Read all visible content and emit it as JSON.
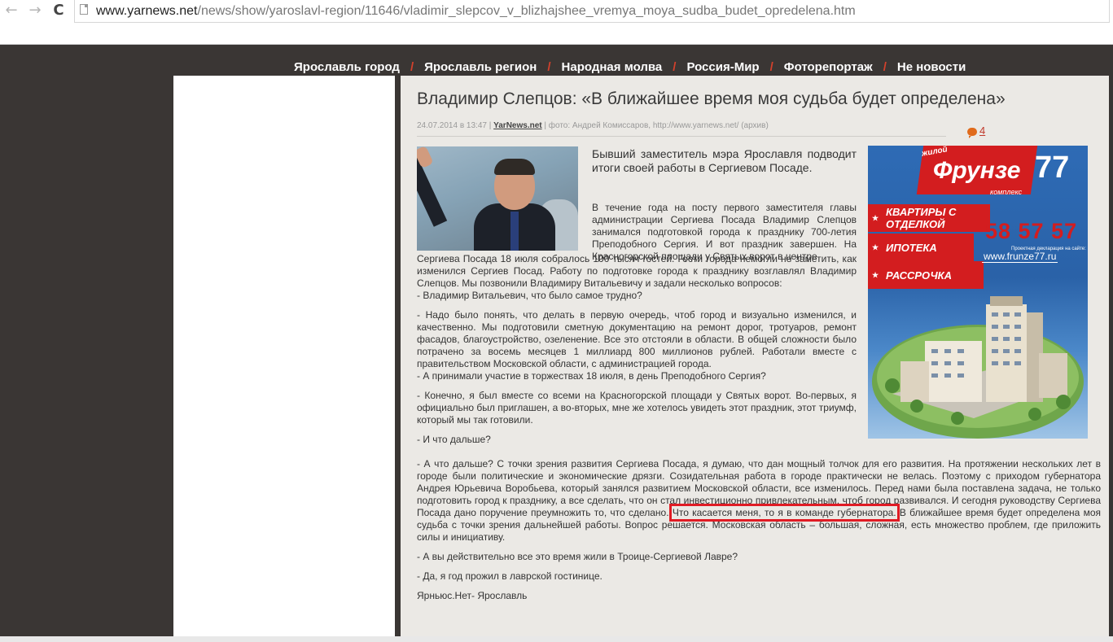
{
  "browser": {
    "url_domain": "www.yarnews.net",
    "url_path": "/news/show/yaroslavl-region/11646/vladimir_slepcov_v_blizhajshee_vremya_moya_sudba_budet_opredelena.htm",
    "back_glyph": "←",
    "forward_glyph": "→",
    "reload_glyph": "C"
  },
  "nav": {
    "items": [
      "Ярославль город",
      "Ярославль регион",
      "Народная молва",
      "Россия-Мир",
      "Фоторепортаж",
      "Не новости"
    ],
    "separator": "/"
  },
  "article": {
    "title": "Владимир Слепцов: «В ближайшее время моя судьба будет определена»",
    "date": "24.07.2014 в 13:47",
    "sep": "|",
    "source": "YarNews.net",
    "photo_credit": "| фото: Андрей Комиссаров, http://www.yarnews.net/ (архив)",
    "comments_count": "4",
    "lead": "Бывший заместитель мэра Ярославля подводит итоги своей работы в Сергиевом Посаде.",
    "p1": "В течение года на посту первого заместителя главы администрации Сергиева Посада Владимир Слепцов занимался подготовкой города к празднику 700-летия Преподобного Сергия. И вот праздник завершен. На Красногорской площади у Святых ворот в центре",
    "p1_cont": "Сергиева Посада 18 июля собралось 100 тысяч гостей. Гости города немогли не заметить, как изменился Сергиев Посад. Работу по подготовке города к празднику возглавлял Владимир Слепцов. Мы позвонили Владимиру Витальевичу и задали несколько вопросов:",
    "q1": "-  Владимир Витальевич, что было самое трудно?",
    "a1": "- Надо было понять, что делать в первую очередь, чтоб город и визуально изменился, и качественно. Мы подготовили сметную документацию на ремонт дорог, тротуаров, ремонт фасадов, благоустройство, озеленение. Все это отстояли в области. В общей сложности было потрачено за восемь месяцев 1 миллиард 800 миллионов рублей. Работали вместе с правительством Московской области, с администрацией города.",
    "q2": "- А принимали участие в торжествах 18 июля, в день Преподобного Сергия?",
    "a2": "- Конечно, я был вместе со всеми на Красногорской площади у Святых ворот. Во-первых, я официально был приглашен, а во-вторых, мне же хотелось увидеть этот праздник, этот триумф, который мы так готовили.",
    "q3": "- И что дальше?",
    "a3_before": "- А что дальше? С точки зрения развития Сергиева Посада, я думаю, что дан мощный толчок для его развития. На протяжении нескольких лет в городе были политические и экономические дрязги. Созидательная работа в городе практически не велась. Поэтому с приходом губернатора Андрея Юрьевича Воробьева, который занялся развитием Московской области, все изменилось. Перед нами была поставлена задача, не только подготовить город к празднику, а все сделать, что он стал инвестиционно привлекательным, чтоб город развивался. И сегодня руководству Сергиева Посада дано поручение преумножить то, что сделано. ",
    "a3_highlight": "Что касается меня, то я в команде губернатора.",
    "a3_after": " В ближайшее время будет определена моя судьба с точки зрения дальнейшей работы. Вопрос решается. Московская область – большая, сложная, есть множество проблем, где приложить силы и инициативу.",
    "q4": "- А вы действительно все это время жили в Троице-Сергиевой Лавре?",
    "a4": "- Да, я год прожил в лаврской гостинице.",
    "signature": "Ярньюс.Нет- Ярославль"
  },
  "ad": {
    "logo_small": "жилой",
    "logo": "Фрунзе",
    "logo_num": "77",
    "logo_sub": "комплекс",
    "band1": "КВАРТИРЫ С ОТДЕЛКОЙ",
    "band2": "ИПОТЕКА",
    "band3": "РАССРОЧКА",
    "phone": "58 57 57",
    "declaration": "Проектная декларация на сайте:",
    "site": "www.frunze77.ru"
  },
  "colors": {
    "page_bg": "#3a3634",
    "content_bg": "#ebe9e5",
    "nav_separator": "#d4412c",
    "highlight": "#e01b24",
    "ad_red": "#d31d1f",
    "ad_blue": "#2e6bb5"
  }
}
